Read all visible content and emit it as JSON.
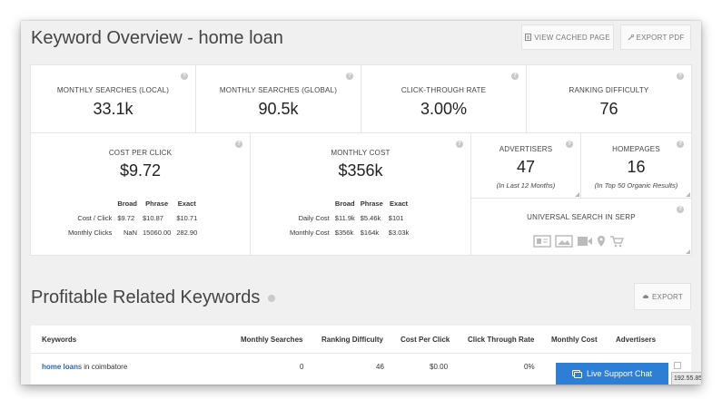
{
  "header": {
    "title": "Keyword Overview - home loan",
    "view_cached": "VIEW CACHED PAGE",
    "export_pdf": "EXPORT PDF"
  },
  "metrics": {
    "monthly_local": {
      "label": "MONTHLY SEARCHES (LOCAL)",
      "value": "33.1k"
    },
    "monthly_global": {
      "label": "MONTHLY SEARCHES (GLOBAL)",
      "value": "90.5k"
    },
    "ctr": {
      "label": "CLICK-THROUGH RATE",
      "value": "3.00%"
    },
    "ranking_difficulty": {
      "label": "RANKING DIFFICULTY",
      "value": "76"
    }
  },
  "cpc": {
    "label": "COST PER CLICK",
    "value": "$9.72",
    "headers": [
      "Broad",
      "Phrase",
      "Exact"
    ],
    "rows": [
      {
        "label": "Cost / Click",
        "values": [
          "$9.72",
          "$10.87",
          "$10.71"
        ]
      },
      {
        "label": "Monthly Clicks",
        "values": [
          "NaN",
          "15060.00",
          "282.90"
        ]
      }
    ]
  },
  "monthly_cost": {
    "label": "MONTHLY COST",
    "value": "$356k",
    "headers": [
      "Broad",
      "Phrase",
      "Exact"
    ],
    "rows": [
      {
        "label": "Daily Cost",
        "values": [
          "$11.9k",
          "$5.46k",
          "$101"
        ]
      },
      {
        "label": "Monthly Cost",
        "values": [
          "$356k",
          "$164k",
          "$3.03k"
        ]
      }
    ]
  },
  "advertisers": {
    "label": "ADVERTISERS",
    "value": "47",
    "sub": "(In Last 12 Months)"
  },
  "homepages": {
    "label": "HOMEPAGES",
    "value": "16",
    "sub": "(In Top 50 Organic Results)"
  },
  "universal": {
    "label": "UNIVERSAL SEARCH IN SERP"
  },
  "related": {
    "title": "Profitable Related Keywords",
    "export": "EXPORT",
    "columns": [
      "Keywords",
      "Monthly Searches",
      "Ranking Difficulty",
      "Cost Per Click",
      "Click Through Rate",
      "Monthly Cost",
      "Advertisers"
    ],
    "row": {
      "keyword_bold": "home loan",
      "keyword_rest": "s in coimbatore",
      "monthly_searches": "0",
      "ranking_difficulty": "46",
      "cpc": "$0.00",
      "ctr": "0%"
    }
  },
  "chat": {
    "label": "Live Support Chat"
  },
  "ip": "192.55.85"
}
